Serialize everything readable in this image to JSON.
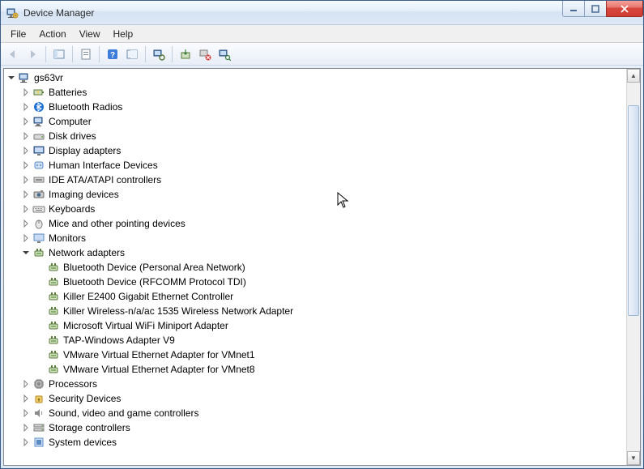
{
  "window": {
    "title": "Device Manager"
  },
  "menubar": {
    "items": [
      "File",
      "Action",
      "View",
      "Help"
    ]
  },
  "toolbar": {
    "buttons": [
      {
        "name": "back-icon"
      },
      {
        "name": "forward-icon"
      },
      {
        "name": "show-hide-tree-icon"
      },
      {
        "name": "properties-icon"
      },
      {
        "name": "help-icon"
      },
      {
        "name": "action-icon"
      },
      {
        "name": "view-icon"
      },
      {
        "name": "update-driver-icon"
      },
      {
        "name": "uninstall-icon"
      },
      {
        "name": "scan-hardware-icon"
      }
    ]
  },
  "tree": {
    "root": {
      "label": "gs63vr",
      "icon": "computer-icon",
      "expanded": true
    },
    "categories": [
      {
        "label": "Batteries",
        "icon": "battery-icon",
        "expanded": false
      },
      {
        "label": "Bluetooth Radios",
        "icon": "bluetooth-icon",
        "expanded": false
      },
      {
        "label": "Computer",
        "icon": "computer-icon",
        "expanded": false
      },
      {
        "label": "Disk drives",
        "icon": "disk-icon",
        "expanded": false
      },
      {
        "label": "Display adapters",
        "icon": "display-icon",
        "expanded": false
      },
      {
        "label": "Human Interface Devices",
        "icon": "hid-icon",
        "expanded": false
      },
      {
        "label": "IDE ATA/ATAPI controllers",
        "icon": "ide-icon",
        "expanded": false
      },
      {
        "label": "Imaging devices",
        "icon": "imaging-icon",
        "expanded": false
      },
      {
        "label": "Keyboards",
        "icon": "keyboard-icon",
        "expanded": false
      },
      {
        "label": "Mice and other pointing devices",
        "icon": "mouse-icon",
        "expanded": false
      },
      {
        "label": "Monitors",
        "icon": "monitor-icon",
        "expanded": false
      },
      {
        "label": "Network adapters",
        "icon": "network-icon",
        "expanded": true,
        "children": [
          {
            "label": "Bluetooth Device (Personal Area Network)",
            "icon": "net-device-icon"
          },
          {
            "label": "Bluetooth Device (RFCOMM Protocol TDI)",
            "icon": "net-device-icon"
          },
          {
            "label": "Killer E2400 Gigabit Ethernet Controller",
            "icon": "net-device-icon"
          },
          {
            "label": "Killer Wireless-n/a/ac 1535 Wireless Network Adapter",
            "icon": "net-device-icon"
          },
          {
            "label": "Microsoft Virtual WiFi Miniport Adapter",
            "icon": "net-device-icon"
          },
          {
            "label": "TAP-Windows Adapter V9",
            "icon": "net-device-icon"
          },
          {
            "label": "VMware Virtual Ethernet Adapter for VMnet1",
            "icon": "net-device-icon"
          },
          {
            "label": "VMware Virtual Ethernet Adapter for VMnet8",
            "icon": "net-device-icon"
          }
        ]
      },
      {
        "label": "Processors",
        "icon": "cpu-icon",
        "expanded": false
      },
      {
        "label": "Security Devices",
        "icon": "security-icon",
        "expanded": false
      },
      {
        "label": "Sound, video and game controllers",
        "icon": "sound-icon",
        "expanded": false
      },
      {
        "label": "Storage controllers",
        "icon": "storage-icon",
        "expanded": false
      },
      {
        "label": "System devices",
        "icon": "system-icon",
        "expanded": false
      }
    ]
  }
}
